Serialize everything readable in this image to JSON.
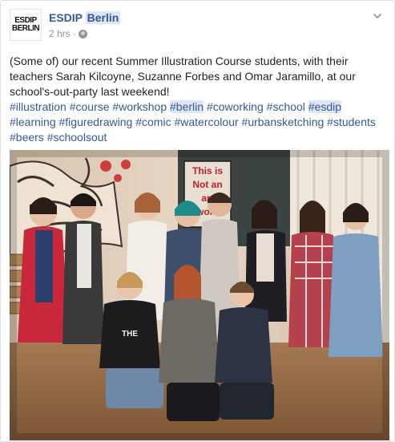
{
  "post": {
    "page": {
      "name_part1": "ESDIP",
      "name_part2": "Berlin"
    },
    "avatar": {
      "line1": "ESDIP",
      "line2": "BERLIN"
    },
    "time": "2 hrs",
    "separator": "·",
    "text": "(Some of) our recent Summer Illustration Course students, with their teachers Sarah Kilcoyne, Suzanne Forbes and Omar Jaramillo, at our school's-out-party last weekend!",
    "hashtags": [
      "#illustration",
      "#course",
      "#workshop",
      "#berlin",
      "#coworking",
      "#school",
      "#esdip",
      "#learning",
      "#figuredrawing",
      "#comic",
      "#watercolour",
      "#urbansketching",
      "#students",
      "#beers",
      "#schoolsout"
    ],
    "highlighted_hashtags": [
      "#berlin",
      "#esdip"
    ],
    "photo": {
      "sign_lines": [
        "This is",
        "Not an",
        "art",
        "work"
      ],
      "shirt_text": "THE"
    }
  },
  "icons": {
    "menu": "chevron-down-icon",
    "audience": "globe-icon"
  },
  "colors": {
    "link": "#365899",
    "text": "#1d2129",
    "meta": "#90949c",
    "highlight": "#dde6f5"
  }
}
